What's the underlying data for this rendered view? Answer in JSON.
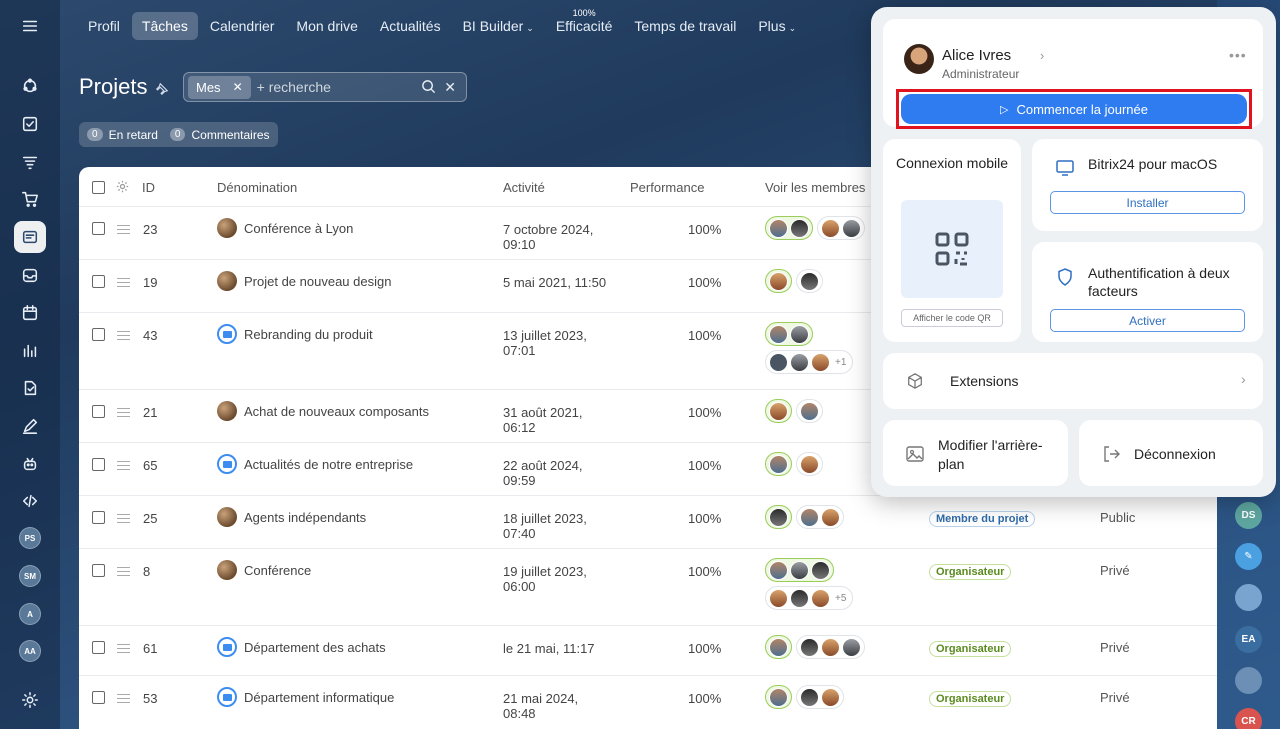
{
  "topnav": {
    "items": [
      {
        "label": "Profil"
      },
      {
        "label": "Tâches",
        "active": true
      },
      {
        "label": "Calendrier"
      },
      {
        "label": "Mon drive"
      },
      {
        "label": "Actualités"
      },
      {
        "label": "BI Builder",
        "caret": true
      },
      {
        "label": "Efficacité",
        "badge": "100%"
      },
      {
        "label": "Temps de travail"
      },
      {
        "label": "Plus",
        "caret": true
      }
    ]
  },
  "page": {
    "title": "Projets",
    "filter_chip": "Mes",
    "search_placeholder": "+ recherche",
    "counters": [
      {
        "count": "0",
        "label": "En retard"
      },
      {
        "count": "0",
        "label": "Commentaires"
      }
    ]
  },
  "table": {
    "headers": {
      "id": "ID",
      "name": "Dénomination",
      "activity": "Activité",
      "performance": "Performance",
      "members": "Voir les membres"
    },
    "rows": [
      {
        "id": "23",
        "name": "Conférence à Lyon",
        "icon": "photo",
        "date": "7 octobre 2024, 09:10",
        "perf": "100%"
      },
      {
        "id": "19",
        "name": "Projet de nouveau design",
        "icon": "photo",
        "date": "5 mai 2021, 11:50",
        "perf": "100%"
      },
      {
        "id": "43",
        "name": "Rebranding du produit",
        "icon": "folder",
        "date": "13 juillet 2023, 07:01",
        "perf": "100%",
        "more": "+1"
      },
      {
        "id": "21",
        "name": "Achat de nouveaux composants",
        "icon": "photo",
        "date": "31 août 2021, 06:12",
        "perf": "100%"
      },
      {
        "id": "65",
        "name": "Actualités de notre entreprise",
        "icon": "folder",
        "date": "22 août 2024, 09:59",
        "perf": "100%"
      },
      {
        "id": "25",
        "name": "Agents indépendants",
        "icon": "photo",
        "date": "18 juillet 2023, 07:40",
        "perf": "100%",
        "role": "Membre du projet",
        "visibility": "Public"
      },
      {
        "id": "8",
        "name": "Conférence",
        "icon": "photo",
        "date": "19 juillet 2023, 06:00",
        "perf": "100%",
        "more": "+5",
        "role": "Organisateur",
        "visibility": "Privé"
      },
      {
        "id": "61",
        "name": "Département des achats",
        "icon": "folder",
        "date": "le 21 mai, 11:17",
        "perf": "100%",
        "role": "Organisateur",
        "visibility": "Privé"
      },
      {
        "id": "53",
        "name": "Département informatique",
        "icon": "folder",
        "date": "21 mai 2024, 08:48",
        "perf": "100%",
        "role": "Organisateur",
        "visibility": "Privé"
      }
    ]
  },
  "rail": {
    "avatars": [
      "PS",
      "SM",
      "A",
      "AA"
    ]
  },
  "right_edge": {
    "avatars": [
      "DS",
      "EA",
      "CR"
    ]
  },
  "popup": {
    "user_name": "Alice Ivres",
    "user_role": "Administrateur",
    "start_button": "Commencer la journée",
    "mobile_title": "Connexion mobile",
    "qr_button": "Afficher le code QR",
    "mac_title": "Bitrix24 pour macOS",
    "mac_button": "Installer",
    "auth_title": "Authentification à deux facteurs",
    "auth_button": "Activer",
    "extensions": "Extensions",
    "background": "Modifier l'arrière-plan",
    "logout": "Déconnexion"
  },
  "colors": {
    "accent": "#2f7bf0",
    "highlight_frame": "#e0141e",
    "member_green": "#9acd5a"
  }
}
